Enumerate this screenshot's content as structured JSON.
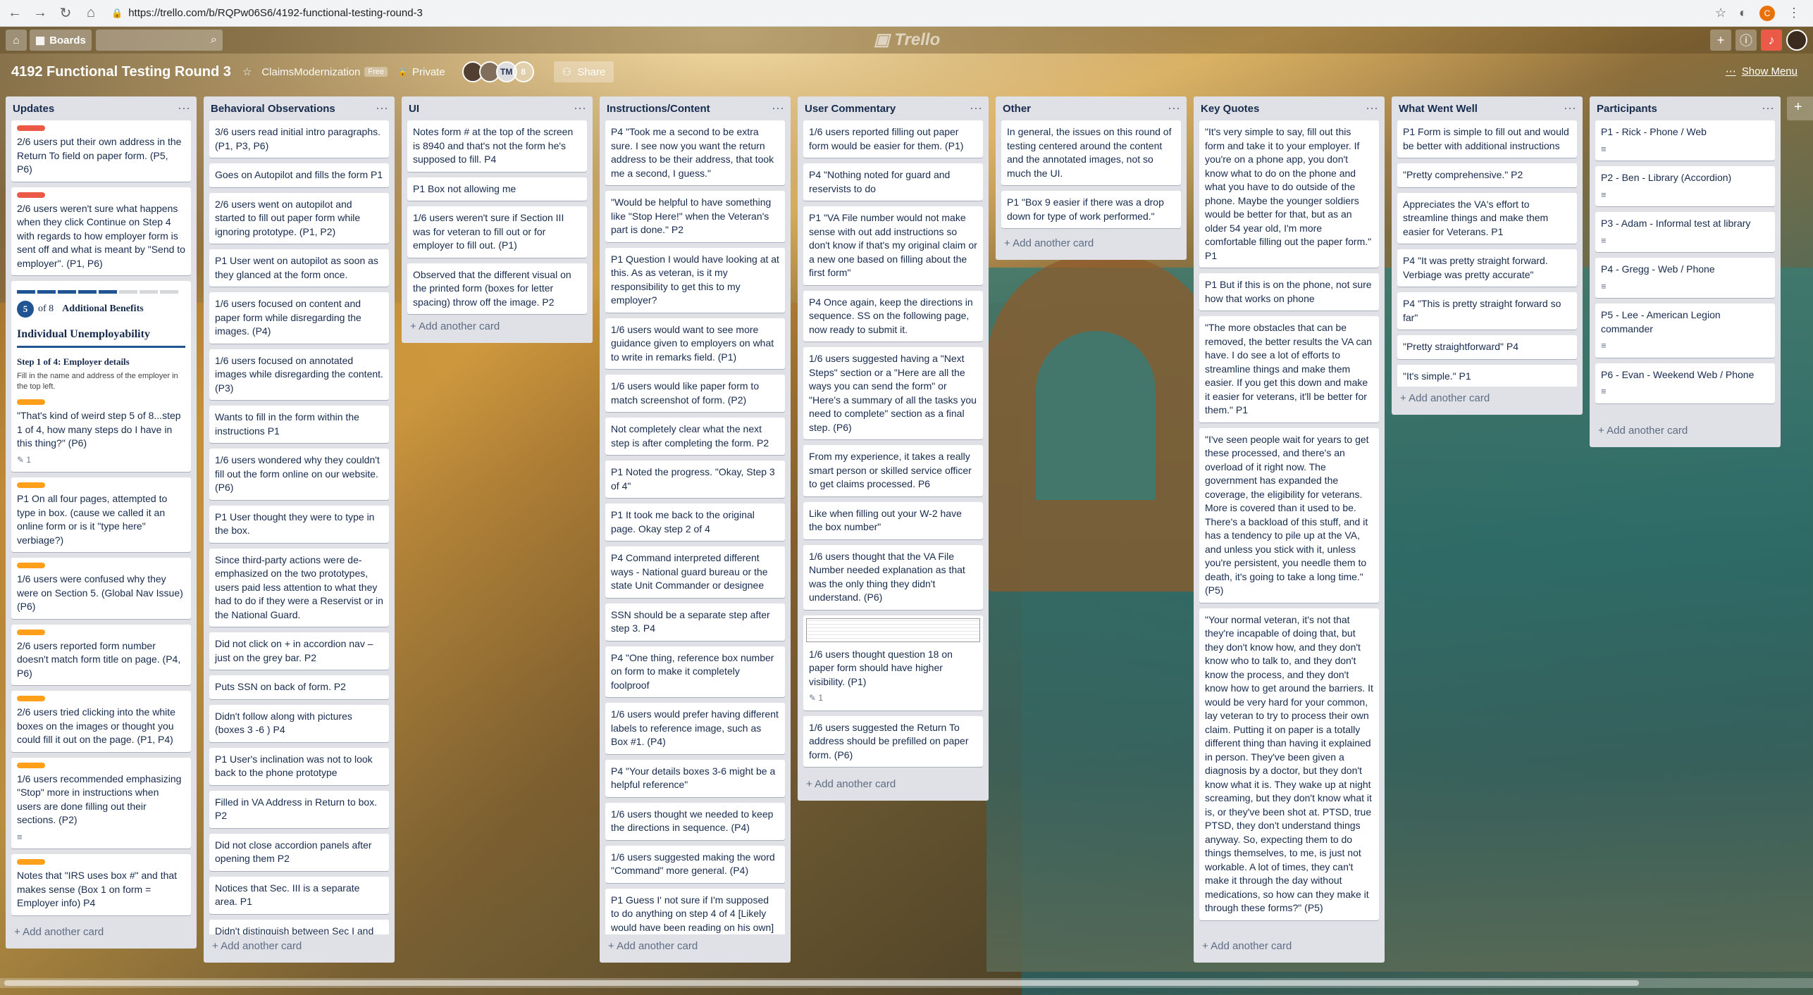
{
  "browser": {
    "url": "https://trello.com/b/RQPw06S6/4192-functional-testing-round-3"
  },
  "header": {
    "boards_label": "Boards",
    "logo": "Trello"
  },
  "board": {
    "title": "4192 Functional Testing Round 3",
    "team": "ClaimsModernization",
    "team_badge": "Free",
    "visibility": "Private",
    "member_initials": "TM",
    "member_extra": "8",
    "share_label": "Share",
    "show_menu": "Show Menu"
  },
  "add_card_label": "+ Add another card",
  "lists": [
    {
      "title": "Updates",
      "cards": [
        {
          "label": "red",
          "text": "2/6 users put their own address in the Return To field on paper form. (P5, P6)"
        },
        {
          "label": "red",
          "text": "2/6 users weren't sure what happens when they click Continue on Step 4 with regards to how employer form is sent off and what is meant by \"Send to employer\". (P1, P6)"
        },
        {
          "type": "form",
          "step": "5",
          "of_label": "of 8",
          "step_title": "Additional Benefits",
          "heading": "Individual Unemployability",
          "sub": "Step 1 of 4: Employer details",
          "p": "Fill in the name and address of the employer in the top left.",
          "label": "orange",
          "text": "\"That's kind of weird step 5 of 8...step 1 of 4, how many steps do I have in this thing?\" (P6)",
          "badge": "1"
        },
        {
          "label": "orange",
          "text": "P1 On all four pages, attempted to type in box. (cause we called it an online form or is it \"type here\" verbiage?)"
        },
        {
          "label": "orange",
          "text": "1/6 users were confused why they were on Section 5. (Global Nav Issue) (P6)"
        },
        {
          "label": "orange",
          "text": "2/6 users reported form number doesn't match form title on page. (P4, P6)"
        },
        {
          "label": "orange",
          "text": "2/6 users tried clicking into the white boxes on the images or thought you could fill it out on the page. (P1, P4)"
        },
        {
          "label": "orange",
          "text": "1/6 users recommended emphasizing \"Stop\" more in instructions when users are done filling out their sections. (P2)",
          "desc": "≡"
        },
        {
          "label": "orange",
          "text": "Notes that \"IRS uses box #\" and that makes sense (Box 1 on form = Employer info) P4"
        }
      ]
    },
    {
      "title": "Behavioral Observations",
      "cards": [
        {
          "text": "3/6 users read initial intro paragraphs. (P1, P3, P6)"
        },
        {
          "text": "Goes on Autopilot and fills the form P1"
        },
        {
          "text": "2/6 users went on autopilot and started to fill out paper form while ignoring prototype. (P1, P2)"
        },
        {
          "text": "P1 User went on autopilot as soon as they glanced at the form once."
        },
        {
          "text": "1/6 users focused on content and paper form while disregarding the images. (P4)"
        },
        {
          "text": "1/6 users focused on annotated images while disregarding the content. (P3)"
        },
        {
          "text": "Wants to fill in the form within the instructions P1"
        },
        {
          "text": "1/6 users wondered why they couldn't fill out the form online on our website. (P6)"
        },
        {
          "text": "P1 User thought they were to type in the box."
        },
        {
          "text": "Since third-party actions were de-emphasized on the two prototypes, users paid less attention to what they had to do if they were a Reservist or in the National Guard."
        },
        {
          "text": "Did not click on + in accordion nav – just on the grey bar. P2"
        },
        {
          "text": "Puts SSN on back of form. P2"
        },
        {
          "text": "Didn't follow along with pictures (boxes 3 -6 ) P4"
        },
        {
          "text": "P1 User's inclination was not to look back to the phone prototype"
        },
        {
          "text": "Filled in VA Address in Return to box. P2"
        },
        {
          "text": "Did not close accordion panels after opening them P2"
        },
        {
          "text": "Notices that Sec. III is a separate area. P1"
        },
        {
          "text": "Didn't distinguish between Sec I and"
        }
      ]
    },
    {
      "title": "UI",
      "cards": [
        {
          "text": "Notes form # at the top of the screen is 8940 and that's not the form he's supposed to fill. P4"
        },
        {
          "text": "P1 Box not allowing me"
        },
        {
          "text": "1/6 users weren't sure if Section III was for veteran to fill out or for employer to fill out. (P1)"
        },
        {
          "text": "Observed that the different visual on the printed form (boxes for letter spacing) throw off the image. P2"
        }
      ]
    },
    {
      "title": "Instructions/Content",
      "cards": [
        {
          "text": "P4 \"Took me a second to be extra sure. I see now you want the return address to be their address, that took me a second, I guess.\""
        },
        {
          "text": "\"Would be helpful to have something like \"Stop Here!\" when the Veteran's part is done.\" P2"
        },
        {
          "text": "P1 Question I would have looking at at this. As as veteran, is it my responsibility to get this to my employer?"
        },
        {
          "text": "1/6 users would want to see more guidance given to employers on what to write in remarks field. (P1)"
        },
        {
          "text": "1/6 users would like paper form to match screenshot of form. (P2)"
        },
        {
          "text": "Not completely clear what the next step is after completing the form. P2"
        },
        {
          "text": "P1 Noted the progress. \"Okay, Step 3 of 4\""
        },
        {
          "text": "P1 It took me back to the original page. Okay step 2 of 4"
        },
        {
          "text": "P4 Command interpreted different ways - National guard bureau or the state Unit Commander or designee"
        },
        {
          "text": "SSN should be a separate step after step 3. P4"
        },
        {
          "text": "P4 \"One thing, reference box number on form to make it completely foolproof"
        },
        {
          "text": "1/6 users would prefer having different labels to reference image, such as Box #1. (P4)"
        },
        {
          "text": "P4 \"Your details boxes 3-6 might be a helpful reference\""
        },
        {
          "text": "1/6 users thought we needed to keep the directions in sequence. (P4)"
        },
        {
          "text": "1/6 users suggested making the word \"Command\" more general. (P4)"
        },
        {
          "text": "P1 Guess I' not sure if I'm supposed to do anything on step 4 of 4 [Likely would have been reading on his own]"
        }
      ]
    },
    {
      "title": "User Commentary",
      "cards": [
        {
          "text": "1/6 users reported filling out paper form would be easier for them. (P1)"
        },
        {
          "text": "P4 \"Nothing noted for guard and reservists to do"
        },
        {
          "text": "P1 \"VA File number would not make sense with out add instructions so don't know if that's my original claim or a new one based on filling about the first form\""
        },
        {
          "text": "P4 Once again, keep the directions in sequence. SS on the following page, now ready to submit it."
        },
        {
          "text": "1/6 users suggested having a \"Next Steps\" section or a \"Here are all the ways you can send the form\" or \"Here's a summary of all the tasks you need to complete\" section as a final step. (P6)"
        },
        {
          "text": "From my experience, it takes a really smart person or skilled service officer to get claims processed. P6"
        },
        {
          "text": "Like when filling out your W-2 have the box number\""
        },
        {
          "text": "1/6 users thought that the VA File Number needed explanation as that was the only thing they didn't understand. (P6)"
        },
        {
          "type": "thumb",
          "text": "1/6 users thought question 18 on paper form should have higher visibility. (P1)",
          "badge": "1"
        },
        {
          "text": "1/6 users suggested the Return To address should be prefilled on paper form. (P6)"
        }
      ]
    },
    {
      "title": "Other",
      "cards": [
        {
          "text": "In general, the issues on this round of testing centered around the content and the annotated images, not so much the UI."
        },
        {
          "text": "P1 \"Box 9 easier if there was a drop down for type of work performed.\""
        }
      ]
    },
    {
      "title": "Key Quotes",
      "cards": [
        {
          "text": "\"It's very simple to say, fill out this form and take it to your employer. If you're on a phone app, you don't know what to do on the phone and what you have to do outside of the phone. Maybe the younger soldiers would be better for that, but as an older 54 year old, I'm more comfortable filling out the paper form.\" P1"
        },
        {
          "text": "P1 But if this is on the phone, not sure how that works on phone"
        },
        {
          "text": "\"The more obstacles that can be removed, the better results the VA can have. I do see a lot of efforts to streamline things and make them easier. If you get this down and make it easier for veterans, it'll be better for them.\" P1"
        },
        {
          "text": "\"I've seen people wait for years to get these processed, and there's an overload of it right now. The government has expanded the coverage, the eligibility for veterans. More is covered than it used to be. There's a backload of this stuff, and it has a tendency to pile up at the VA, and unless you stick with it, unless you're persistent, you needle them to death, it's going to take a long time.\" (P5)"
        },
        {
          "text": "\"Your normal veteran, it's not that they're incapable of doing that, but they don't know how, and they don't know who to talk to, and they don't know the process, and they don't know how to get around the barriers. It would be very hard for your common, lay veteran to try to process their own claim. Putting it on paper is a totally different thing than having it explained in person. They've been given a diagnosis by a doctor, but they don't know what it is. They wake up at night screaming, but they don't know what it is, or they've been shot at. PTSD, true PTSD, they don't understand things anyway. So, expecting them to do things themselves, to me, is just not workable. A lot of times, they can't make it through the day without medications, so how can they make it through these forms?\" (P5)"
        }
      ]
    },
    {
      "title": "What Went Well",
      "cards": [
        {
          "text": "P1 Form is simple to fill out and would be better with additional instructions"
        },
        {
          "text": "\"Pretty comprehensive.\" P2"
        },
        {
          "text": "Appreciates the VA's effort to streamline things and make them easier for Veterans. P1"
        },
        {
          "text": "P4 \"It was pretty straight forward. Verbiage was pretty accurate\""
        },
        {
          "text": "P4 \"This is pretty straight forward so far\""
        },
        {
          "text": "\"Pretty straightforward\" P4"
        },
        {
          "text": "\"It's simple.\" P1"
        }
      ]
    },
    {
      "title": "Participants",
      "cards": [
        {
          "text": "P1 - Rick - Phone / Web",
          "desc": "≡"
        },
        {
          "text": "P2 - Ben - Library (Accordion)",
          "desc": "≡"
        },
        {
          "text": "P3 - Adam - Informal test at library",
          "desc": "≡"
        },
        {
          "text": "P4 - Gregg - Web / Phone",
          "desc": "≡"
        },
        {
          "text": "P5 - Lee - American Legion commander",
          "desc": "≡"
        },
        {
          "text": "P6 - Evan - Weekend Web / Phone",
          "desc": "≡"
        }
      ]
    }
  ]
}
